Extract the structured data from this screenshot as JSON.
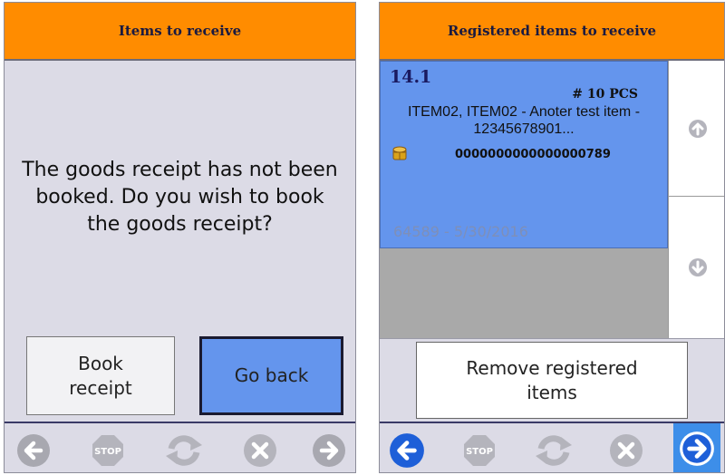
{
  "left": {
    "title": "Items to receive",
    "message": "The goods receipt has not been booked. Do you wish to book the goods receipt?",
    "book_receipt_label": "Book receipt",
    "go_back_label": "Go back",
    "nav": [
      "back-arrow-icon",
      "stop-icon",
      "refresh-icon",
      "cancel-icon",
      "forward-arrow-icon"
    ]
  },
  "right": {
    "title": "Registered items to receive",
    "item": {
      "position": "14.1",
      "quantity": "# 10 PCS",
      "description": "ITEM02, ITEM02 - Anoter test item - 12345678901...",
      "barcode": "0000000000000000789",
      "footer": "64589 - 5/30/2016"
    },
    "remove_label": "Remove registered items",
    "nav": [
      "back-arrow-icon",
      "stop-icon",
      "refresh-icon",
      "cancel-icon",
      "forward-arrow-icon"
    ]
  },
  "colors": {
    "header": "#ff8c00",
    "selected": "#6495ed",
    "active_nav": "#3d8ee9",
    "disabled_icon": "#a8a8b0"
  }
}
